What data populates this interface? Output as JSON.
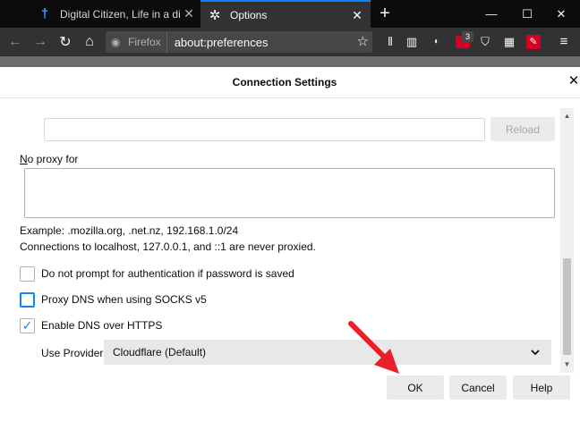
{
  "browser": {
    "tabs": [
      {
        "title": "Digital Citizen, Life in a digital",
        "active": false
      },
      {
        "title": "Options",
        "active": true
      }
    ],
    "url_identity": "Firefox",
    "url": "about:preferences",
    "extension_badge": "3"
  },
  "dialog": {
    "title": "Connection Settings",
    "reload_label": "Reload",
    "no_proxy_label": "No proxy for",
    "no_proxy_value": "",
    "example_hint": "Example: .mozilla.org, .net.nz, 192.168.1.0/24",
    "localhost_hint": "Connections to localhost, 127.0.0.1, and ::1 are never proxied.",
    "checkboxes": [
      {
        "label": "Do not prompt for authentication if password is saved",
        "checked": false
      },
      {
        "label": "Proxy DNS when using SOCKS v5",
        "checked": false
      },
      {
        "label": "Enable DNS over HTTPS",
        "checked": true
      }
    ],
    "provider_label": "Use Provider",
    "provider_value": "Cloudflare (Default)",
    "buttons": {
      "ok": "OK",
      "cancel": "Cancel",
      "help": "Help"
    }
  },
  "colors": {
    "accent": "#0a84ff",
    "annotation_arrow": "#e8202a",
    "titlebar": "#0c0c0d",
    "toolbar": "#323234"
  },
  "icons": [
    "back-arrow-icon",
    "forward-arrow-icon",
    "reload-icon",
    "home-icon",
    "firefox-icon",
    "bookmark-star-icon",
    "library-icon",
    "sidebar-icon",
    "hamburger-menu-icon",
    "settings-gear-icon"
  ]
}
